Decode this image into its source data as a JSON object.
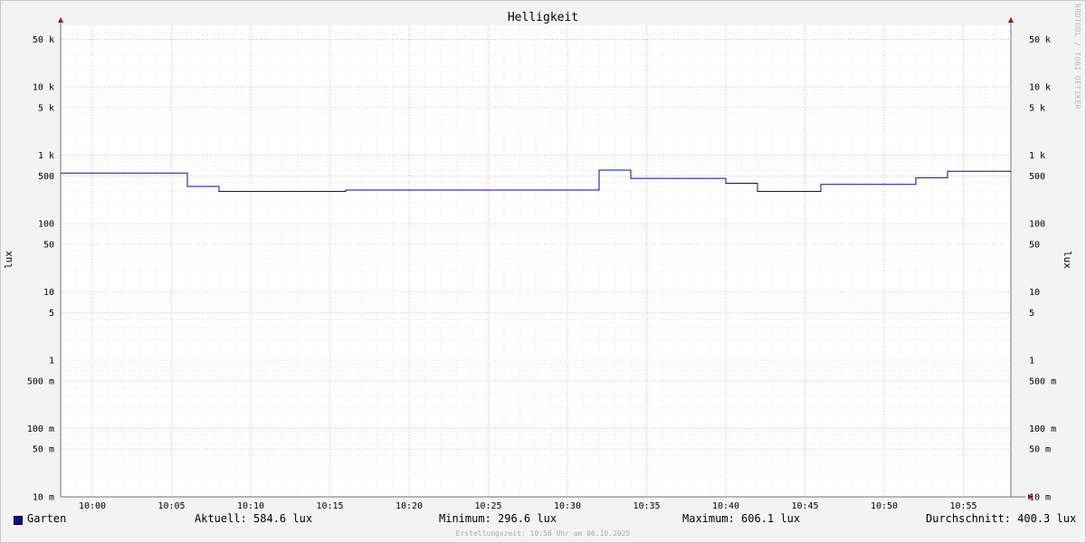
{
  "chart_data": {
    "type": "line",
    "title": "Helligkeit",
    "ylabel": "lux",
    "yscale": "log",
    "ylim": [
      0.01,
      80000
    ],
    "xlim": [
      "09:58",
      "10:58"
    ],
    "x_ticks": [
      "10:00",
      "10:05",
      "10:10",
      "10:15",
      "10:20",
      "10:25",
      "10:30",
      "10:35",
      "10:40",
      "10:45",
      "10:50",
      "10:55"
    ],
    "y_ticks": [
      {
        "value": 50000,
        "label": "50 k"
      },
      {
        "value": 10000,
        "label": "10 k"
      },
      {
        "value": 5000,
        "label": "5 k"
      },
      {
        "value": 1000,
        "label": "1 k"
      },
      {
        "value": 500,
        "label": "500"
      },
      {
        "value": 100,
        "label": "100"
      },
      {
        "value": 50,
        "label": "50"
      },
      {
        "value": 10,
        "label": "10"
      },
      {
        "value": 5,
        "label": "5"
      },
      {
        "value": 1,
        "label": "1"
      },
      {
        "value": 0.5,
        "label": "500 m"
      },
      {
        "value": 0.1,
        "label": "100 m"
      },
      {
        "value": 0.05,
        "label": "50 m"
      },
      {
        "value": 0.01,
        "label": "10 m"
      }
    ],
    "grid": true,
    "series": [
      {
        "name": "Garten",
        "color": "#0a0aa0",
        "step": true,
        "points": [
          {
            "x": "09:58",
            "y": 550
          },
          {
            "x": "10:06",
            "y": 350
          },
          {
            "x": "10:08",
            "y": 296.6
          },
          {
            "x": "10:16",
            "y": 310
          },
          {
            "x": "10:32",
            "y": 606.1
          },
          {
            "x": "10:34",
            "y": 460
          },
          {
            "x": "10:40",
            "y": 390
          },
          {
            "x": "10:42",
            "y": 296.6
          },
          {
            "x": "10:46",
            "y": 375
          },
          {
            "x": "10:52",
            "y": 470
          },
          {
            "x": "10:54",
            "y": 584.6
          }
        ]
      }
    ]
  },
  "legend": {
    "series_name": "Garten",
    "current": "Aktuell: 584.6 lux",
    "minimum": "Minimum: 296.6 lux",
    "maximum": "Maximum: 606.1 lux",
    "average": "Durchschnitt: 400.3 lux"
  },
  "footer": "Erstellungszeit: 10:58 Uhr am 06.10.2025",
  "watermark": "RRDTOOL / TOBI OETIKER"
}
